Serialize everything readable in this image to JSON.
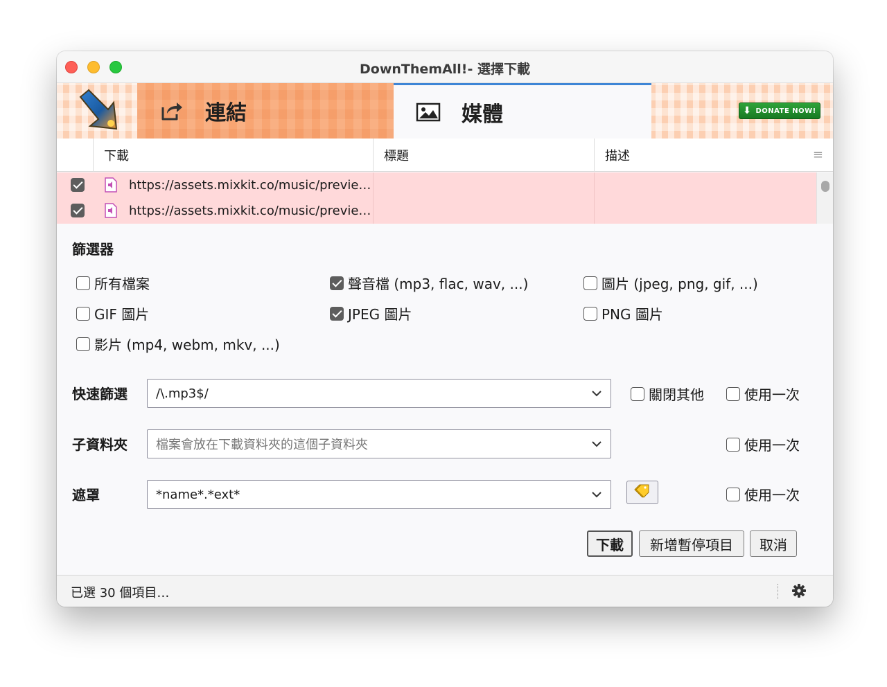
{
  "window": {
    "title": "DownThemAll!- 選擇下載"
  },
  "header": {
    "tabs": [
      {
        "label": "連結",
        "icon": "share-icon"
      },
      {
        "label": "媒體",
        "icon": "image-icon"
      }
    ],
    "donate_label": "DONATE NOW!"
  },
  "table": {
    "columns": [
      "下載",
      "標題",
      "描述"
    ],
    "rows": [
      {
        "checked": true,
        "url": "https://assets.mixkit.co/music/previe…",
        "title": "",
        "description": ""
      },
      {
        "checked": true,
        "url": "https://assets.mixkit.co/music/previe…",
        "title": "",
        "description": ""
      }
    ]
  },
  "filters": {
    "title": "篩選器",
    "options": [
      {
        "label": "所有檔案",
        "checked": false
      },
      {
        "label": "聲音檔 (mp3, flac, wav, ...)",
        "checked": true
      },
      {
        "label": "圖片 (jpeg, png, gif, ...)",
        "checked": false
      },
      {
        "label": "GIF 圖片",
        "checked": false
      },
      {
        "label": "JPEG 圖片",
        "checked": true
      },
      {
        "label": "PNG 圖片",
        "checked": false
      },
      {
        "label": "影片 (mp4, webm, mkv, ...)",
        "checked": false
      }
    ]
  },
  "form": {
    "fast_filter": {
      "label": "快速篩選",
      "value": "/\\.mp3$/",
      "close_others": "關閉其他",
      "use_once": "使用一次"
    },
    "subfolder": {
      "label": "子資料夾",
      "placeholder": "檔案會放在下載資料夾的這個子資料夾",
      "use_once": "使用一次"
    },
    "mask": {
      "label": "遮罩",
      "value": "*name*.*ext*",
      "use_once": "使用一次"
    }
  },
  "buttons": {
    "download": "下載",
    "add_paused": "新增暫停項目",
    "cancel": "取消"
  },
  "status": {
    "text": "已選 30 個項目…"
  },
  "colors": {
    "accent": "#3f86d6",
    "row_highlight": "#ffd9da",
    "links_tab": "#f8a572",
    "donate": "#2fa33a"
  }
}
